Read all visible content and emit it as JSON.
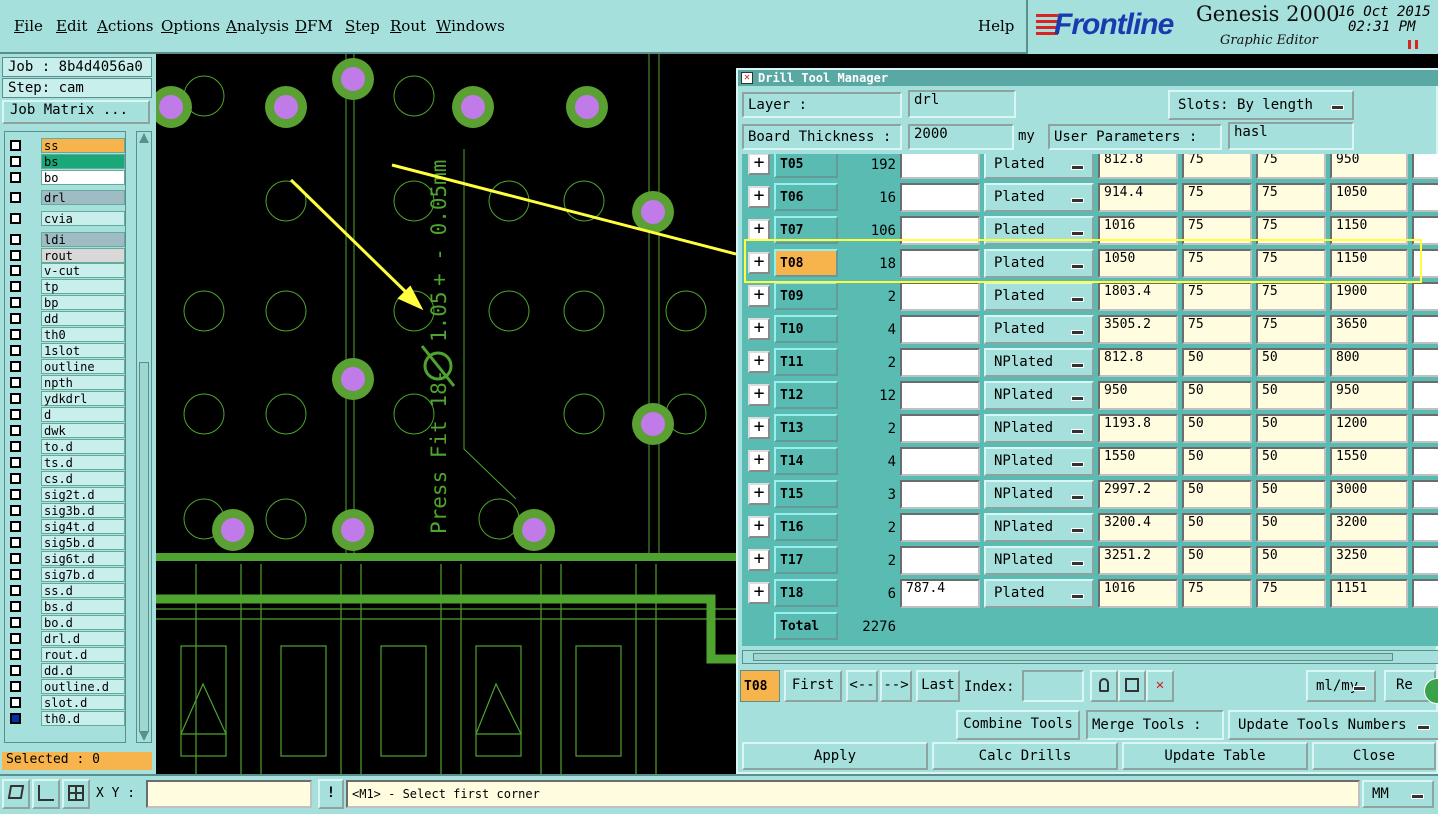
{
  "menu": {
    "items": [
      "File",
      "Edit",
      "Actions",
      "Options",
      "Analysis",
      "DFM",
      "Step",
      "Rout",
      "Windows"
    ],
    "help": "Help"
  },
  "brand": {
    "logo": "Frontline",
    "product": "Genesis 2000",
    "subtitle": "Graphic Editor",
    "date": "16 Oct 2015",
    "time": "02:31 PM"
  },
  "job": {
    "job_label": "Job : 8b4d4056a0",
    "step_label": "Step: cam",
    "matrix_btn": "Job Matrix ...",
    "selected": "Selected : 0"
  },
  "layers": [
    {
      "name": "ss",
      "color": "#f8b44c"
    },
    {
      "name": "bs",
      "color": "#1aa87a"
    },
    {
      "name": "bo",
      "color": "#ffffff"
    },
    {
      "name": "drl",
      "color": "#9fbcc4"
    },
    {
      "name": "cvia",
      "color": "#c8efeb"
    },
    {
      "name": "ldi",
      "color": "#9fbcc4"
    },
    {
      "name": "rout",
      "color": "#d8d8d8"
    },
    {
      "name": "v-cut"
    },
    {
      "name": "tp"
    },
    {
      "name": "bp"
    },
    {
      "name": "dd"
    },
    {
      "name": "th0"
    },
    {
      "name": "1slot"
    },
    {
      "name": "outline"
    },
    {
      "name": "npth"
    },
    {
      "name": "ydkdrl"
    },
    {
      "name": "d"
    },
    {
      "name": "dwk"
    },
    {
      "name": "to.d"
    },
    {
      "name": "ts.d"
    },
    {
      "name": "cs.d"
    },
    {
      "name": "sig2t.d"
    },
    {
      "name": "sig3b.d"
    },
    {
      "name": "sig4t.d"
    },
    {
      "name": "sig5b.d"
    },
    {
      "name": "sig6t.d"
    },
    {
      "name": "sig7b.d"
    },
    {
      "name": "ss.d"
    },
    {
      "name": "bs.d"
    },
    {
      "name": "bo.d"
    },
    {
      "name": "drl.d"
    },
    {
      "name": "rout.d"
    },
    {
      "name": "dd.d"
    },
    {
      "name": "outline.d"
    },
    {
      "name": "slot.d"
    },
    {
      "name": "th0.d"
    }
  ],
  "canvas": {
    "annotation": "Press Fit 18-",
    "dim_text": "1.05",
    "tol_text": "+ - 0.05mm"
  },
  "dtm": {
    "title": "Drill Tool Manager",
    "layer_label": "Layer :",
    "layer_value": "drl",
    "slots_label": "Slots:",
    "slots_value": "By length",
    "thickness_label": "Board Thickness :",
    "thickness_value": "2000",
    "thickness_unit": "my",
    "user_params_label": "User Parameters :",
    "user_params_value": "hasl",
    "tools": [
      {
        "name": "T05",
        "count": "192",
        "finish": "",
        "type": "Plated",
        "size": "812.8",
        "tp": "75",
        "tm": "75",
        "drill": "950"
      },
      {
        "name": "T06",
        "count": "16",
        "finish": "",
        "type": "Plated",
        "size": "914.4",
        "tp": "75",
        "tm": "75",
        "drill": "1050"
      },
      {
        "name": "T07",
        "count": "106",
        "finish": "",
        "type": "Plated",
        "size": "1016",
        "tp": "75",
        "tm": "75",
        "drill": "1150"
      },
      {
        "name": "T08",
        "count": "18",
        "finish": "",
        "type": "Plated",
        "size": "1050",
        "tp": "75",
        "tm": "75",
        "drill": "1150"
      },
      {
        "name": "T09",
        "count": "2",
        "finish": "",
        "type": "Plated",
        "size": "1803.4",
        "tp": "75",
        "tm": "75",
        "drill": "1900"
      },
      {
        "name": "T10",
        "count": "4",
        "finish": "",
        "type": "Plated",
        "size": "3505.2",
        "tp": "75",
        "tm": "75",
        "drill": "3650"
      },
      {
        "name": "T11",
        "count": "2",
        "finish": "",
        "type": "NPlated",
        "size": "812.8",
        "tp": "50",
        "tm": "50",
        "drill": "800"
      },
      {
        "name": "T12",
        "count": "12",
        "finish": "",
        "type": "NPlated",
        "size": "950",
        "tp": "50",
        "tm": "50",
        "drill": "950"
      },
      {
        "name": "T13",
        "count": "2",
        "finish": "",
        "type": "NPlated",
        "size": "1193.8",
        "tp": "50",
        "tm": "50",
        "drill": "1200"
      },
      {
        "name": "T14",
        "count": "4",
        "finish": "",
        "type": "NPlated",
        "size": "1550",
        "tp": "50",
        "tm": "50",
        "drill": "1550"
      },
      {
        "name": "T15",
        "count": "3",
        "finish": "",
        "type": "NPlated",
        "size": "2997.2",
        "tp": "50",
        "tm": "50",
        "drill": "3000"
      },
      {
        "name": "T16",
        "count": "2",
        "finish": "",
        "type": "NPlated",
        "size": "3200.4",
        "tp": "50",
        "tm": "50",
        "drill": "3200"
      },
      {
        "name": "T17",
        "count": "2",
        "finish": "",
        "type": "NPlated",
        "size": "3251.2",
        "tp": "50",
        "tm": "50",
        "drill": "3250"
      },
      {
        "name": "T18",
        "count": "6",
        "finish": "787.4",
        "type": "Plated",
        "size": "1016",
        "tp": "75",
        "tm": "75",
        "drill": "1151"
      }
    ],
    "total_label": "Total",
    "total_value": "2276",
    "current_tool": "T08",
    "nav": {
      "first": "First",
      "prev": "<--",
      "next": "-->",
      "last": "Last",
      "index_label": "Index:",
      "units": "ml/my",
      "re": "Re"
    },
    "actions": {
      "combine": "Combine Tools",
      "merge": "Merge Tools :",
      "update_numbers": "Update Tools Numbers"
    },
    "bottom": {
      "apply": "Apply",
      "calc": "Calc Drills",
      "update_table": "Update Table",
      "close": "Close"
    }
  },
  "status": {
    "xy_label": "X Y :",
    "message": "<M1> - Select first corner",
    "units": "MM"
  },
  "colors": {
    "panel": "#a6e0dc",
    "selected_tool": "#f8b44c",
    "pad": "#5aa032",
    "hole": "#c07be8",
    "highlight": "#ffff40"
  }
}
